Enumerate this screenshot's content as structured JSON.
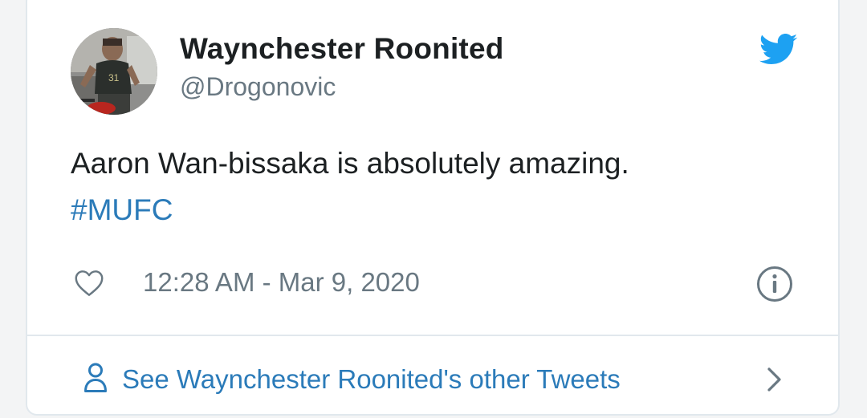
{
  "tweet": {
    "author": {
      "name": "Waynchester Roonited",
      "handle": "@Drogonovic"
    },
    "text": "Aaron Wan-bissaka is absolutely amazing.",
    "hashtag": "#MUFC",
    "timestamp": "12:28 AM - Mar 9, 2020"
  },
  "footer": {
    "link_label": "See Waynchester Roonited's other Tweets"
  },
  "icons": {
    "brand": "twitter-bird-icon",
    "like": "heart-icon",
    "info": "info-icon",
    "profile": "person-icon",
    "more": "chevron-right-icon"
  },
  "colors": {
    "twitter_blue": "#1da1f2",
    "link_blue": "#2b7bb9",
    "text_primary": "#1c2022",
    "text_secondary": "#697882",
    "border": "#e1e8ed"
  }
}
